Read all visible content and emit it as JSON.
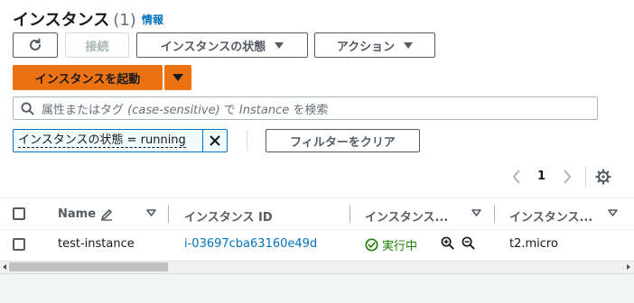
{
  "header": {
    "title": "インスタンス",
    "count": "(1)",
    "info_link": "情報"
  },
  "toolbar": {
    "refresh_icon": "refresh-icon",
    "connect_label": "接続",
    "instance_state_label": "インスタンスの状態",
    "actions_label": "アクション",
    "launch_label": "インスタンスを起動"
  },
  "search": {
    "placeholder_prefix": "属性またはタグ ",
    "placeholder_italic1": "(case-sensitive)",
    "placeholder_mid": " で ",
    "placeholder_italic2": "Instance",
    "placeholder_suffix": " を検索"
  },
  "filter": {
    "chip_label": "インスタンスの状態 = running",
    "clear_label": "フィルターをクリア"
  },
  "pagination": {
    "current_page": "1"
  },
  "table": {
    "columns": [
      {
        "label": "Name"
      },
      {
        "label": "インスタンス ID"
      },
      {
        "label": "インスタンス..."
      },
      {
        "label": "インスタンス..."
      }
    ],
    "rows": [
      {
        "name": "test-instance",
        "instance_id": "i-03697cba63160e49d",
        "state": "実行中",
        "type": "t2.micro"
      }
    ]
  },
  "colors": {
    "accent": "#ec7211",
    "link": "#0073bb",
    "running": "#1d8102"
  }
}
